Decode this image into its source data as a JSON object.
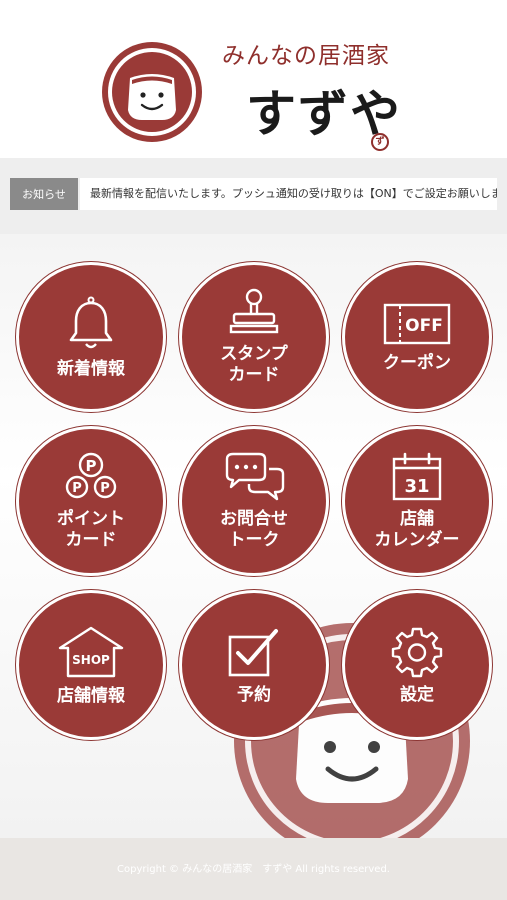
{
  "header": {
    "brand_sub": "みんなの居酒家",
    "brand_main": "すずや",
    "brand_mark": "ず"
  },
  "news": {
    "label": "お知らせ",
    "text": "最新情報を配信いたします。プッシュ通知の受け取りは【ON】でご設定お願いします。"
  },
  "menu": {
    "new_info": "新着情報",
    "stamp_card": "スタンプ\nカード",
    "coupon": "クーポン",
    "coupon_icon_text": "OFF",
    "point_card": "ポイント\nカード",
    "point_icon_text": "P",
    "inquiry_talk": "お問合せ\nトーク",
    "store_calendar": "店舗\nカレンダー",
    "calendar_icon_text": "31",
    "store_info": "店舗情報",
    "shop_icon_text": "SHOP",
    "reservation": "予約",
    "settings": "設定"
  },
  "footer": {
    "copyright": "Copyright © みんなの居酒家　すずや All rights reserved."
  },
  "colors": {
    "brand": "#9a3a37",
    "news_label_bg": "#8a8a8a",
    "footer_bg": "#e9e6e3"
  }
}
